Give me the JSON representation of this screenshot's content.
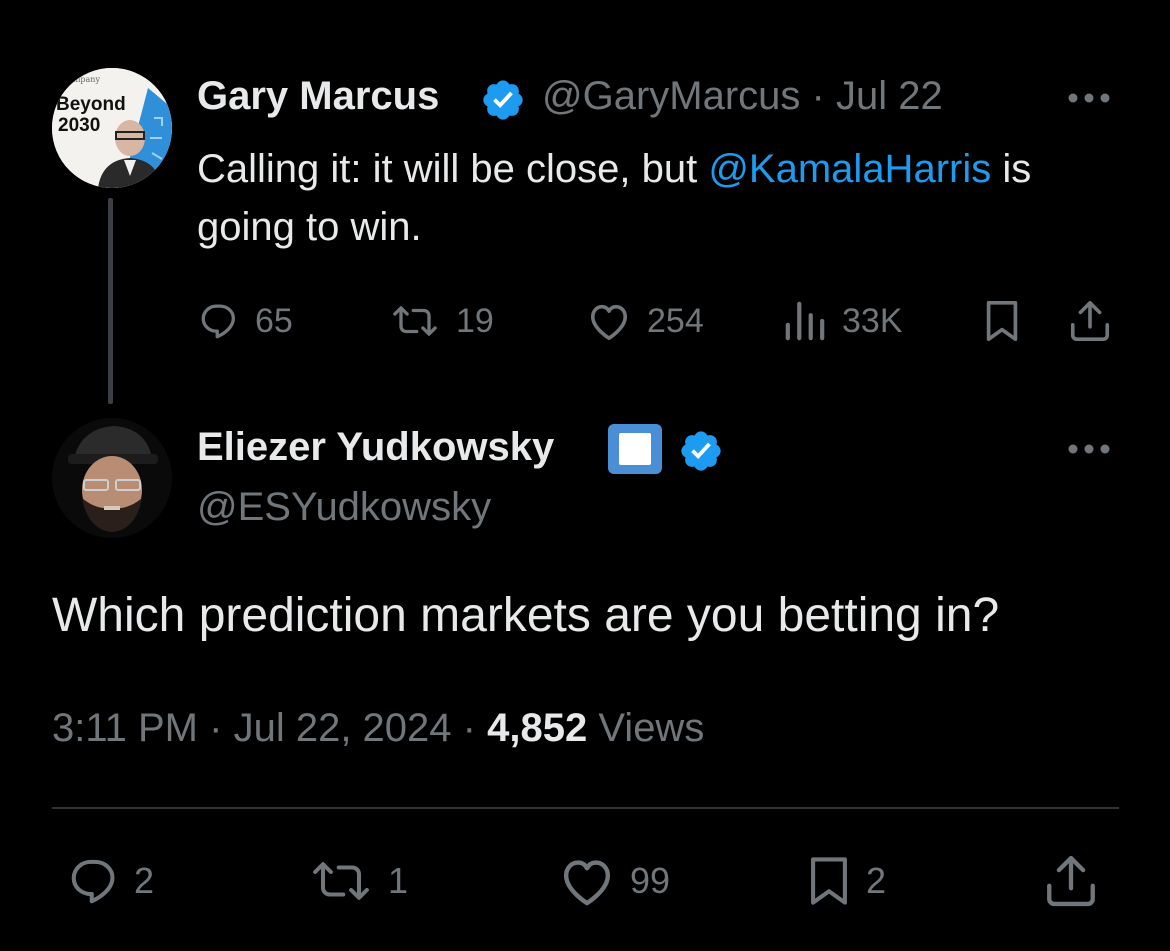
{
  "parent_tweet": {
    "name": "Gary Marcus",
    "handle": "@GaryMarcus",
    "separator": "·",
    "date": "Jul 22",
    "avatar_text_line1": "Beyond",
    "avatar_text_line2": "2030",
    "avatar_text_top": "ompany",
    "text_before_mention": "Calling it: it will be close, but ",
    "mention": "@KamalaHarris",
    "text_after_mention": " is going to win.",
    "stats": {
      "replies": "65",
      "reposts": "19",
      "likes": "254",
      "views": "33K"
    }
  },
  "main_tweet": {
    "name": "Eliezer Yudkowsky",
    "handle": "@ESYudkowsky",
    "text": "Which prediction markets are you betting in?",
    "time": "3:11 PM",
    "date": "Jul 22, 2024",
    "views_count": "4,852",
    "views_label": "Views",
    "stats": {
      "replies": "2",
      "reposts": "1",
      "likes": "99",
      "bookmarks": "2"
    }
  },
  "colors": {
    "background": "#000000",
    "text": "#e7e9ea",
    "muted": "#71767b",
    "accent": "#1d9bf0",
    "divider": "#2f3336"
  },
  "icons": [
    "verified-badge-icon",
    "more-icon",
    "reply-icon",
    "repost-icon",
    "like-icon",
    "views-icon",
    "bookmark-icon",
    "share-icon"
  ]
}
